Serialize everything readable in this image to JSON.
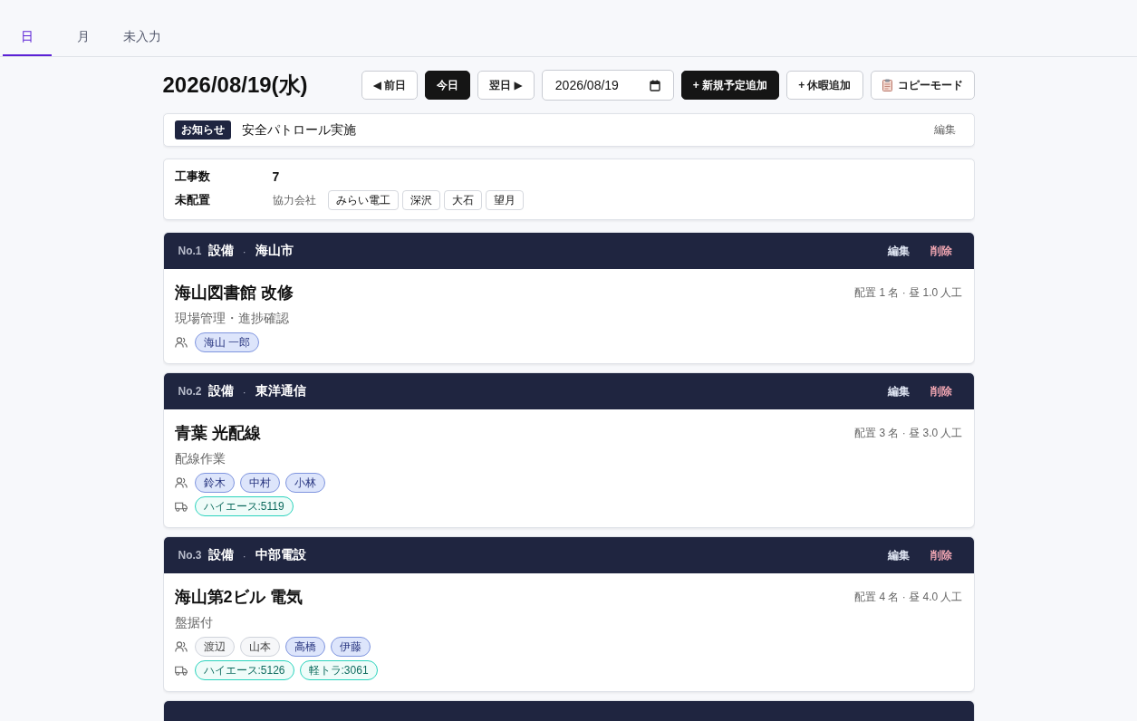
{
  "tabs": [
    {
      "label": "日",
      "selected": true
    },
    {
      "label": "月",
      "selected": false
    },
    {
      "label": "未入力",
      "selected": false
    }
  ],
  "date_heading": "2026/08/19(水)",
  "toolbar": [
    {
      "kind": "button",
      "label": "◀ 前日"
    },
    {
      "kind": "primary",
      "label": "今日"
    },
    {
      "kind": "button",
      "label": "翌日 ▶"
    },
    {
      "kind": "date",
      "label": "2026/08/19"
    },
    {
      "kind": "primary",
      "label": "+ 新規予定追加"
    },
    {
      "kind": "button",
      "label": "+ 休暇追加"
    },
    {
      "kind": "copy",
      "label": "コピーモード"
    }
  ],
  "notice": {
    "badge": "お知らせ",
    "text": "安全パトロール実施",
    "edit": "編集"
  },
  "summary": {
    "count_label": "工事数",
    "count": "7",
    "unassigned_label": "未配置",
    "partner_label": "協力会社",
    "partners": [
      "みらい電工",
      "深沢",
      "大石",
      "望月"
    ]
  },
  "jobs": [
    {
      "kind": "full",
      "no": "No.1",
      "category": "設備",
      "separator": "·",
      "client": "海山市",
      "edit": "編集",
      "delete": "削除",
      "title": "海山図書館 改修",
      "stats": "配置 1 名 · 昼 1.0 人工",
      "task": "現場管理・進捗確認",
      "staff": [
        {
          "name": "海山 一郎",
          "highlighted": true
        }
      ]
    },
    {
      "kind": "full",
      "no": "No.2",
      "category": "設備",
      "separator": "·",
      "client": "東洋通信",
      "edit": "編集",
      "delete": "削除",
      "title": "青葉 光配線",
      "stats": "配置 3 名 · 昼 3.0 人工",
      "task": "配線作業",
      "staff": [
        {
          "name": "鈴木",
          "highlighted": true
        },
        {
          "name": "中村",
          "highlighted": true
        },
        {
          "name": "小林",
          "highlighted": true
        }
      ],
      "vehicles": [
        "ハイエース:5119"
      ]
    },
    {
      "kind": "full",
      "no": "No.3",
      "category": "設備",
      "separator": "·",
      "client": "中部電設",
      "edit": "編集",
      "delete": "削除",
      "title": "海山第2ビル 電気",
      "stats": "配置 4 名 · 昼 4.0 人工",
      "task": "盤据付",
      "staff": [
        {
          "name": "渡辺",
          "highlighted": false
        },
        {
          "name": "山本",
          "highlighted": false
        },
        {
          "name": "高橋",
          "highlighted": true
        },
        {
          "name": "伊藤",
          "highlighted": true
        }
      ],
      "vehicles": [
        "ハイエース:5126",
        "軽トラ:3061"
      ]
    },
    {
      "kind": "cut_off"
    }
  ]
}
